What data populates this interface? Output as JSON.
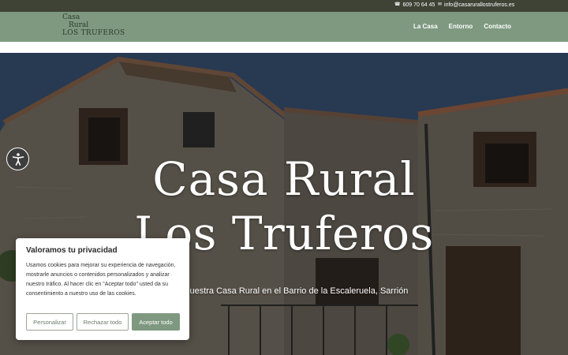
{
  "topbar": {
    "phone_icon": "phone-icon",
    "phone": "609 70 64 45",
    "email_icon": "envelope-icon",
    "email": "info@casarurallostruferos.es"
  },
  "logo": {
    "line1": "Casa",
    "line2": "Rural",
    "line3": "LOS TRUFEROS"
  },
  "nav": {
    "items": [
      "La Casa",
      "Entorno",
      "Contacto"
    ]
  },
  "hero": {
    "title_line1": "Casa Rural",
    "title_line2": "Los Truferos",
    "subtitle": "dos a Nuestra Casa Rural en el Barrio de la Escaleruela, Sarrión"
  },
  "accessibility": {
    "icon": "accessibility-icon"
  },
  "cookie": {
    "title": "Valoramos tu privacidad",
    "text": "Usamos cookies para mejorar su experiencia de navegación, mostrarle anuncios o contenidos personalizados y analizar nuestro tráfico. Al hacer clic en \"Aceptar todo\" usted da su consentimiento a nuestro uso de las cookies.",
    "customize_label": "Personalizar",
    "reject_label": "Rechazar todo",
    "accept_label": "Aceptar todo"
  },
  "colors": {
    "topbar": "#3e4336",
    "header": "#7e9980",
    "accent": "#7e9980"
  }
}
